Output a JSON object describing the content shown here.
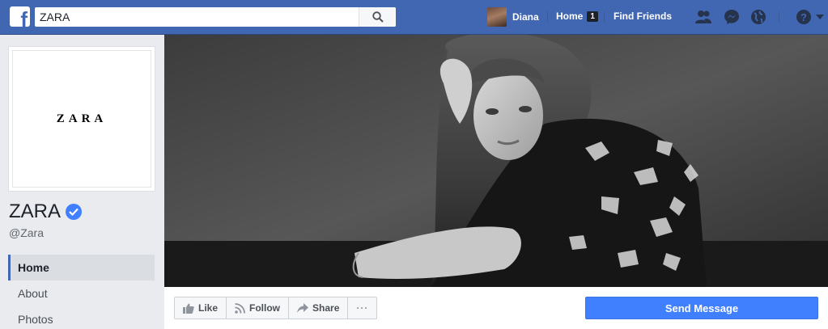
{
  "topbar": {
    "search_value": "ZARA",
    "user_name": "Diana",
    "home_label": "Home",
    "home_count": "1",
    "find_friends_label": "Find Friends"
  },
  "page": {
    "logo_text": "ZARA",
    "name": "ZARA",
    "handle": "@Zara"
  },
  "left_nav": {
    "items": [
      {
        "label": "Home",
        "active": true
      },
      {
        "label": "About",
        "active": false
      },
      {
        "label": "Photos",
        "active": false
      }
    ]
  },
  "actions": {
    "like_label": "Like",
    "follow_label": "Follow",
    "share_label": "Share",
    "more_label": "···",
    "send_message_label": "Send Message"
  },
  "icons": {
    "logo": "facebook-logo-icon",
    "search": "search-icon",
    "friend_requests": "friend-requests-icon",
    "messenger": "messenger-icon",
    "notifications": "globe-icon",
    "help": "help-icon",
    "dropdown": "caret-down-icon",
    "verified": "verified-badge-icon"
  },
  "colors": {
    "brand_blue": "#4267b2",
    "button_blue": "#4080ff",
    "background": "#e9ebee"
  }
}
